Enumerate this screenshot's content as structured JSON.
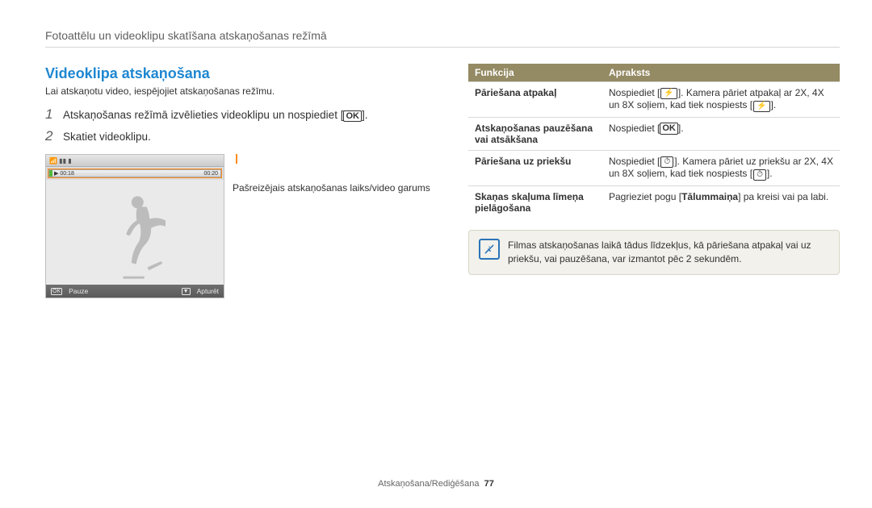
{
  "section_title": "Fotoattēlu un videoklipu skatīšana atskaņošanas režīmā",
  "page_title": "Videoklipa atskaņošana",
  "intro": "Lai atskaņotu video, iespējojiet atskaņošanas režīmu.",
  "steps": [
    {
      "num": "1",
      "prefix": "Atskaņošanas režīmā izvēlieties videoklipu un nospiediet [",
      "suffix": "]."
    },
    {
      "num": "2",
      "text": "Skatiet videoklipu."
    }
  ],
  "glyphs": {
    "ok": "OK",
    "flash": "⚡",
    "timer": "⏱"
  },
  "screenshot": {
    "playback_left": "▶ 00:18",
    "playback_right": "00:20",
    "bottom_left_marker": "OK",
    "bottom_left_label": "Pauze",
    "bottom_right_marker": "▼",
    "bottom_right_label": "Apturēt"
  },
  "caption": "Pašreizējais atskaņošanas laiks/video garums",
  "table": {
    "headers": [
      "Funkcija",
      "Apraksts"
    ],
    "rows": [
      {
        "fn": "Pāriešana atpakaļ",
        "desc_pre": "Nospiediet [",
        "desc_glyph": "flash",
        "desc_mid": "]. Kamera pāriet atpakaļ ar 2X, 4X un 8X soļiem, kad tiek nospiests [",
        "desc_glyph2": "flash",
        "desc_post": "]."
      },
      {
        "fn": "Atskaņošanas pauzēšana vai atsākšana",
        "desc_pre": "Nospiediet [",
        "desc_glyph": "ok",
        "desc_post": "]."
      },
      {
        "fn": "Pāriešana uz priekšu",
        "desc_pre": "Nospiediet [",
        "desc_glyph": "timer",
        "desc_mid": "]. Kamera pāriet uz priekšu ar 2X, 4X un 8X soļiem, kad tiek nospiests [",
        "desc_glyph2": "timer",
        "desc_post": "]."
      },
      {
        "fn": "Skaņas skaļuma līmeņa pielāgošana",
        "desc_html": "Pagrieziet pogu [<b>Tālummaiņa</b>] pa kreisi vai pa labi."
      }
    ]
  },
  "note_text": "Filmas atskaņošanas laikā tādus līdzekļus, kā pāriešana atpakaļ vai uz priekšu, vai pauzēšana, var izmantot pēc 2 sekundēm.",
  "footer": {
    "chapter": "Atskaņošana/Rediģēšana",
    "page": "77"
  }
}
